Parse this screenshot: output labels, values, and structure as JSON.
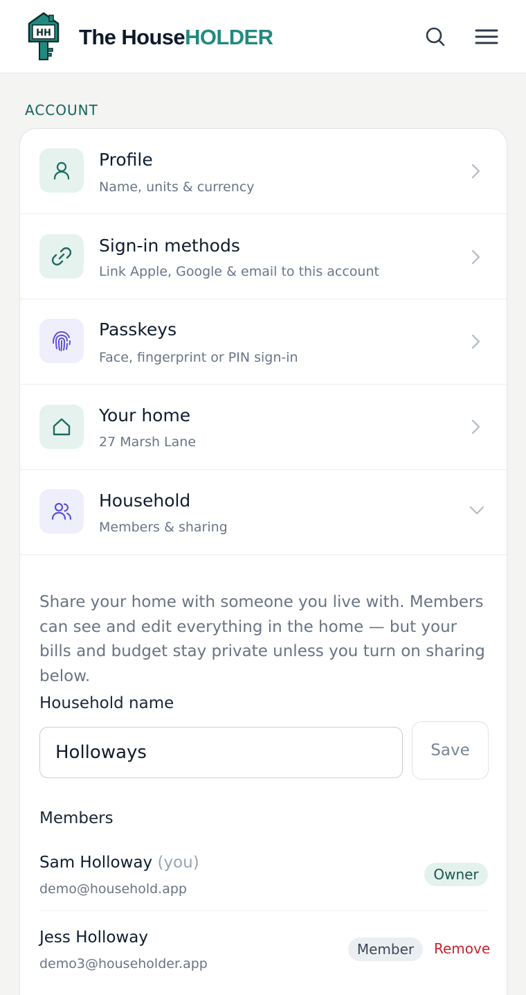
{
  "header": {
    "logo_text": "HH",
    "brand_part1": "The House",
    "brand_part2": "HOLDER",
    "search_icon": "search-icon",
    "menu_icon": "hamburger-menu-icon"
  },
  "section_label": "ACCOUNT",
  "settings_rows": [
    {
      "title": "Profile",
      "subtitle": "Name, units & currency",
      "icon": "user-icon",
      "tint": "green",
      "expanded": false
    },
    {
      "title": "Sign-in methods",
      "subtitle": "Link Apple, Google & email to this account",
      "icon": "link-icon",
      "tint": "green",
      "expanded": false
    },
    {
      "title": "Passkeys",
      "subtitle": "Face, fingerprint or PIN sign-in",
      "icon": "fingerprint-icon",
      "tint": "purple",
      "expanded": false
    },
    {
      "title": "Your home",
      "subtitle": "27 Marsh Lane",
      "icon": "home-icon",
      "tint": "green",
      "expanded": false
    },
    {
      "title": "Household",
      "subtitle": "Members & sharing",
      "icon": "users-icon",
      "tint": "purple",
      "expanded": true
    }
  ],
  "household": {
    "description": "Share your home with someone you live with. Members can see and edit everything in the home — but your bills and budget stay private unless you turn on sharing below.",
    "name_label": "Household name",
    "name_value": "Holloways",
    "save_label": "Save",
    "members_label": "Members",
    "members": [
      {
        "name": "Sam Holloway",
        "you_tag": "(you)",
        "email": "demo@household.app",
        "role": "Owner"
      },
      {
        "name": "Jess Holloway",
        "you_tag": "",
        "email": "demo3@householder.app",
        "role": "Member",
        "action": "Remove"
      }
    ]
  },
  "colors": {
    "accent_teal": "#1f8a80",
    "section_green": "#13665c",
    "remove_red": "#c8232c",
    "icon_green": "#1a6b5f",
    "icon_purple": "#5b4fd6"
  }
}
